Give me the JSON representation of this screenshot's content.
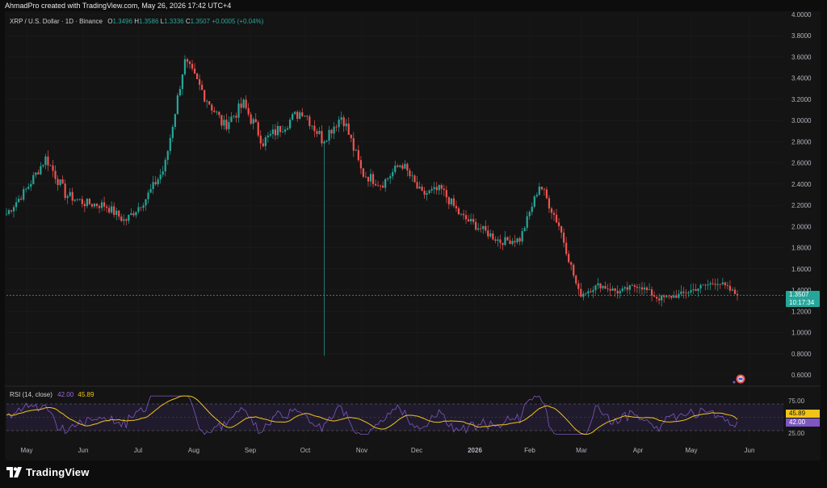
{
  "header": {
    "creator_text": "AhmadPro created with TradingView.com, May 26, 2026 17:42 UTC+4"
  },
  "legend": {
    "symbol": "XRP / U.S. Dollar · 1D · Binance",
    "o_label": "O",
    "o_value": "1.3496",
    "h_label": "H",
    "h_value": "1.3586",
    "l_label": "L",
    "l_value": "1.3336",
    "c_label": "C",
    "c_value": "1.3507",
    "change": "+0.0005 (+0.04%)"
  },
  "price_axis": {
    "ticks": [
      "4.0000",
      "3.8000",
      "3.6000",
      "3.4000",
      "3.2000",
      "3.0000",
      "2.8000",
      "2.6000",
      "2.4000",
      "2.2000",
      "2.0000",
      "1.8000",
      "1.6000",
      "1.4000",
      "1.2000",
      "1.0000",
      "0.8000",
      "0.6000"
    ],
    "current_price": "1.3507",
    "countdown": "10:17:34"
  },
  "rsi": {
    "title": "RSI (14, close)",
    "value_rsi": "42.00",
    "value_ma": "45.89",
    "ticks": [
      "75.00",
      "25.00"
    ]
  },
  "time_axis": {
    "labels": [
      "May",
      "Jun",
      "Jul",
      "Aug",
      "Sep",
      "Oct",
      "Nov",
      "Dec",
      "2026",
      "Feb",
      "Mar",
      "Apr",
      "May",
      "Jun"
    ]
  },
  "footer": {
    "brand": "TradingView"
  },
  "colors": {
    "up": "#26a69a",
    "down": "#ef5350",
    "rsi_line": "#7e57c2",
    "rsi_ma": "#f0c419",
    "background": "#141414"
  },
  "chart_data": {
    "type": "candlestick",
    "instrument": "XRP / U.S. Dollar",
    "ylim": [
      0.6,
      4.0
    ],
    "anchors": [
      [
        "May",
        2.12
      ],
      [
        "May",
        2.35
      ],
      [
        "May",
        2.65
      ],
      [
        "May",
        2.3
      ],
      [
        "Jun",
        2.22
      ],
      [
        "Jun",
        2.2
      ],
      [
        "Jun",
        2.05
      ],
      [
        "Jul",
        2.25
      ],
      [
        "Jul",
        2.55
      ],
      [
        "Jul",
        3.55
      ],
      [
        "Aug",
        3.25
      ],
      [
        "Aug",
        2.95
      ],
      [
        "Aug",
        3.15
      ],
      [
        "Sep",
        2.8
      ],
      [
        "Sep",
        2.95
      ],
      [
        "Sep",
        3.1
      ],
      [
        "Sep",
        2.82
      ],
      [
        "Oct",
        3.05
      ],
      [
        "Oct",
        2.5
      ],
      [
        "Oct",
        2.4
      ],
      [
        "Nov",
        2.6
      ],
      [
        "Nov",
        2.3
      ],
      [
        "Nov",
        2.35
      ],
      [
        "Dec",
        2.1
      ],
      [
        "Dec",
        1.98
      ],
      [
        "Dec",
        1.86
      ],
      [
        "2026",
        1.88
      ],
      [
        "2026",
        2.4
      ],
      [
        "2026",
        2.0
      ],
      [
        "Feb",
        1.35
      ],
      [
        "Feb",
        1.45
      ],
      [
        "Mar",
        1.38
      ],
      [
        "Mar",
        1.45
      ],
      [
        "Apr",
        1.32
      ],
      [
        "Apr",
        1.35
      ],
      [
        "May",
        1.42
      ],
      [
        "May",
        1.48
      ],
      [
        "May",
        1.35
      ]
    ],
    "spike_low": 0.78,
    "last_close": 1.3507,
    "rsi": {
      "ylim": [
        0,
        100
      ],
      "upper": 75,
      "lower": 25,
      "last_rsi": 42.0,
      "last_ma": 45.89
    }
  }
}
